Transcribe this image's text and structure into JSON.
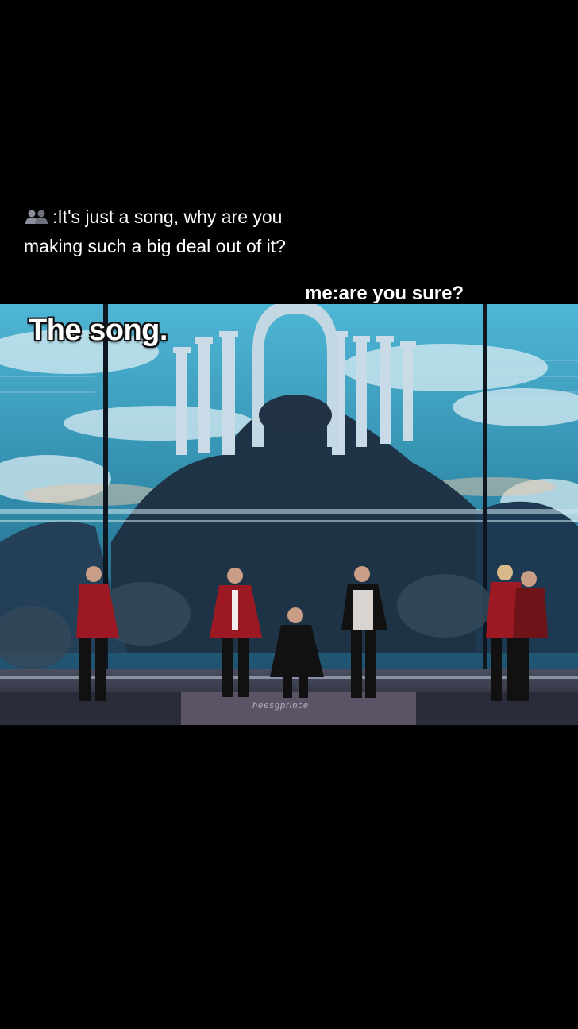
{
  "caption": {
    "line1": ":It's just a song, why are you",
    "line2": "making such a big deal out of it?",
    "icon": "people-icon",
    "reply": "me:are you sure?"
  },
  "frame": {
    "title": "The song.",
    "watermark": "heesgprince"
  },
  "colors": {
    "background": "#000000",
    "sky": "#3aa8c8",
    "stage_floor": "#2a2c3a",
    "costume_red": "#9c1822"
  }
}
